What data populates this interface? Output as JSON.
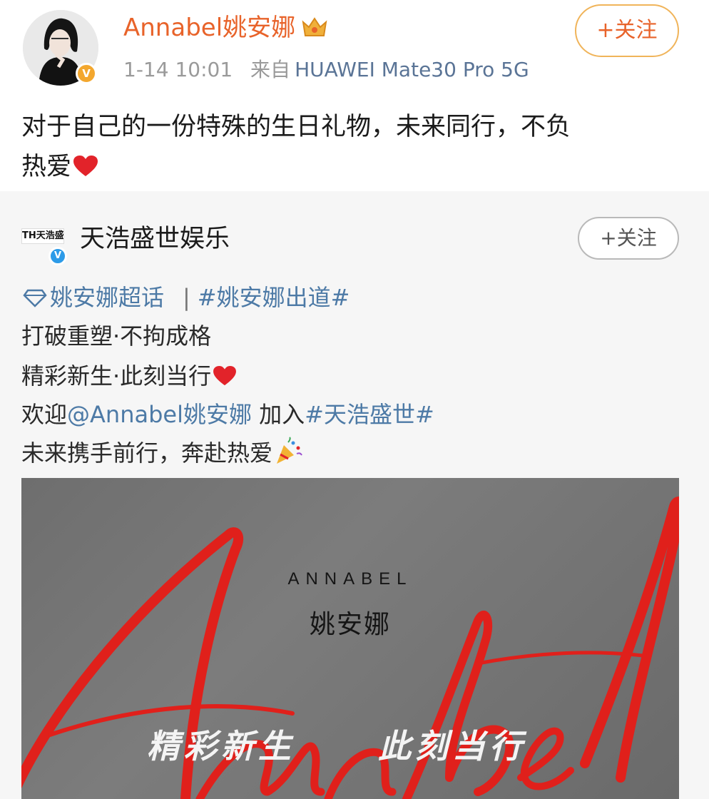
{
  "post": {
    "author": "Annabel姚安娜",
    "time": "1-14 10:01",
    "source_prefix": "来自",
    "source_device": "HUAWEI Mate30 Pro 5G",
    "follow_label": "+关注",
    "text_line1": "对于自己的一份特殊的生日礼物，未来同行，不负",
    "text_line2": "热爱",
    "icons": [
      "avatar-photo",
      "verified-badge",
      "crown-icon",
      "heart-icon"
    ]
  },
  "repost": {
    "org_logo_text": "TH天浩盛世",
    "org_name": "天浩盛世娱乐",
    "follow_label": "+关注",
    "supertopic": "姚安娜超话",
    "separator": "|",
    "hashtag1": "#姚安娜出道#",
    "line1": "打破重塑·不拘成格",
    "line2": "精彩新生·此刻当行",
    "line3_prefix": "欢迎",
    "line3_mention": "@Annabel姚安娜",
    "line3_middle": " 加入",
    "line3_hashtag": "#天浩盛世#",
    "line4": "未来携手前行，奔赴热爱",
    "icons": [
      "diamond-icon",
      "heart-icon",
      "party-popper-icon",
      "verified-badge"
    ]
  },
  "poster": {
    "en_name": "ANNABEL",
    "cn_name": "姚安娜",
    "slogan1": "精彩新生",
    "slogan2": "此刻当行",
    "script_text": "Annabel",
    "colors": {
      "script": "#e0201b",
      "background": "#757575"
    }
  },
  "colors": {
    "author_orange": "#e8632a",
    "link_blue": "#4d7aa6",
    "follow_border": "#f0b45a",
    "meta_gray": "#9a9a9a"
  }
}
